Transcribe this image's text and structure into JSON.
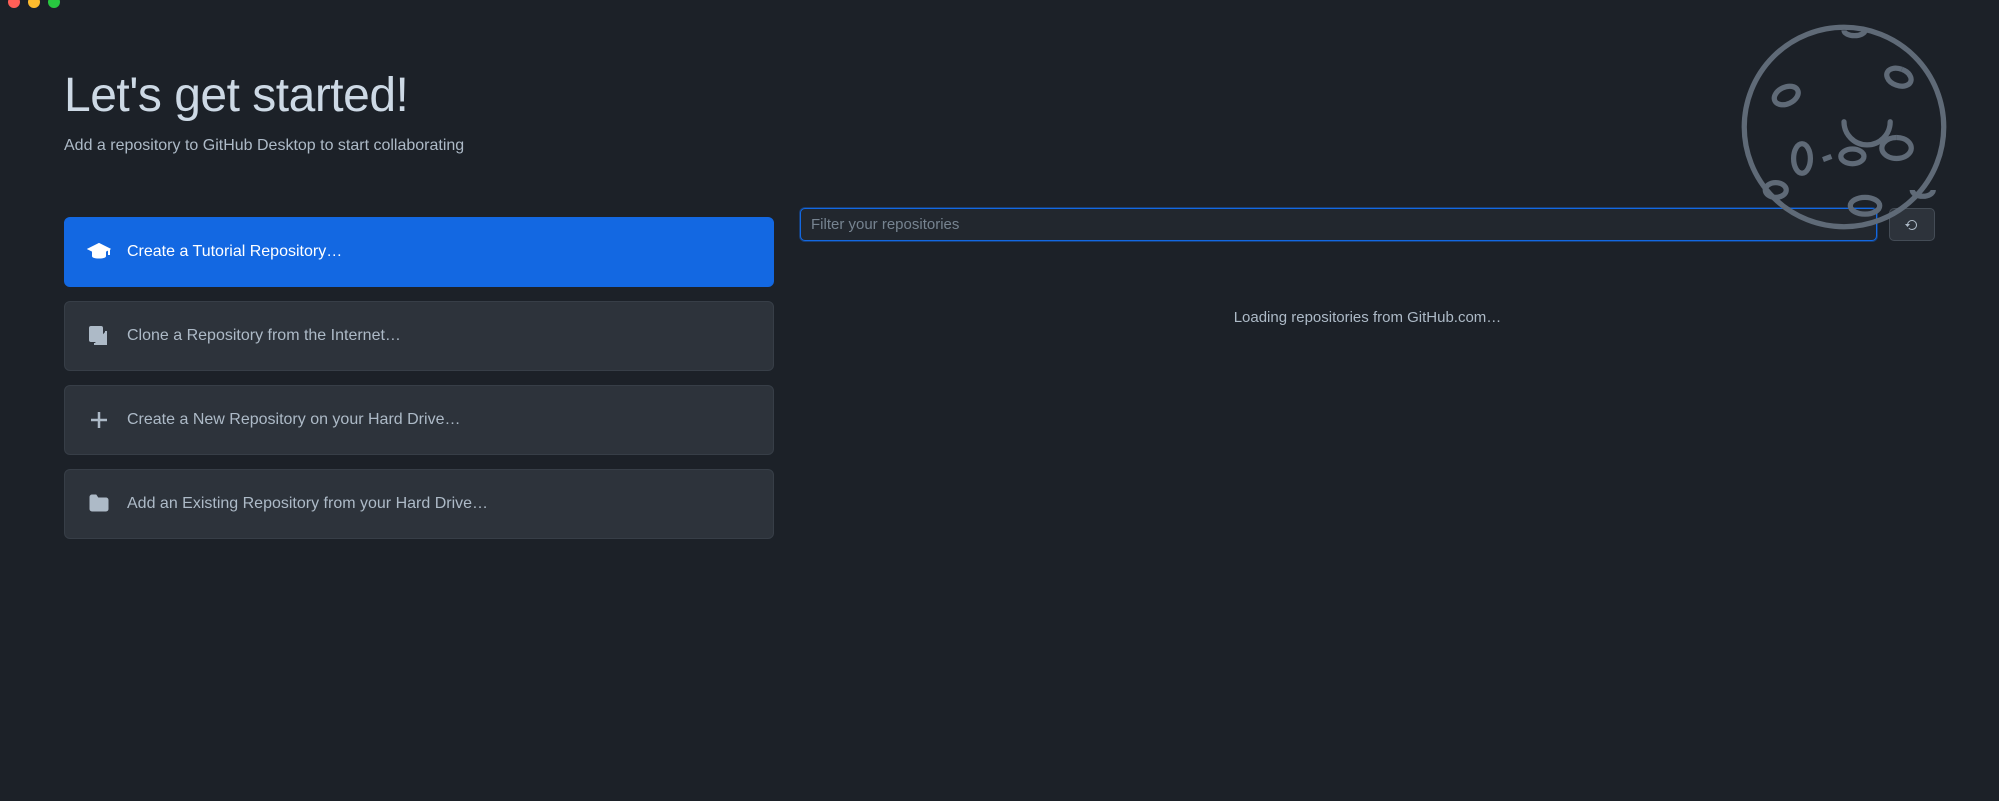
{
  "header": {
    "title": "Let's get started!",
    "subtitle": "Add a repository to GitHub Desktop to start collaborating"
  },
  "actions": {
    "tutorial": "Create a Tutorial Repository…",
    "clone": "Clone a Repository from the Internet…",
    "create": "Create a New Repository on your Hard Drive…",
    "add_existing": "Add an Existing Repository from your Hard Drive…"
  },
  "filter": {
    "placeholder": "Filter your repositories",
    "value": ""
  },
  "status": {
    "loading": "Loading repositories from GitHub.com…"
  },
  "icons": {
    "tutorial": "graduation-cap-icon",
    "clone": "clone-repo-icon",
    "create": "plus-icon",
    "add_existing": "folder-icon",
    "refresh": "refresh-icon",
    "decoration": "moon-icon"
  }
}
